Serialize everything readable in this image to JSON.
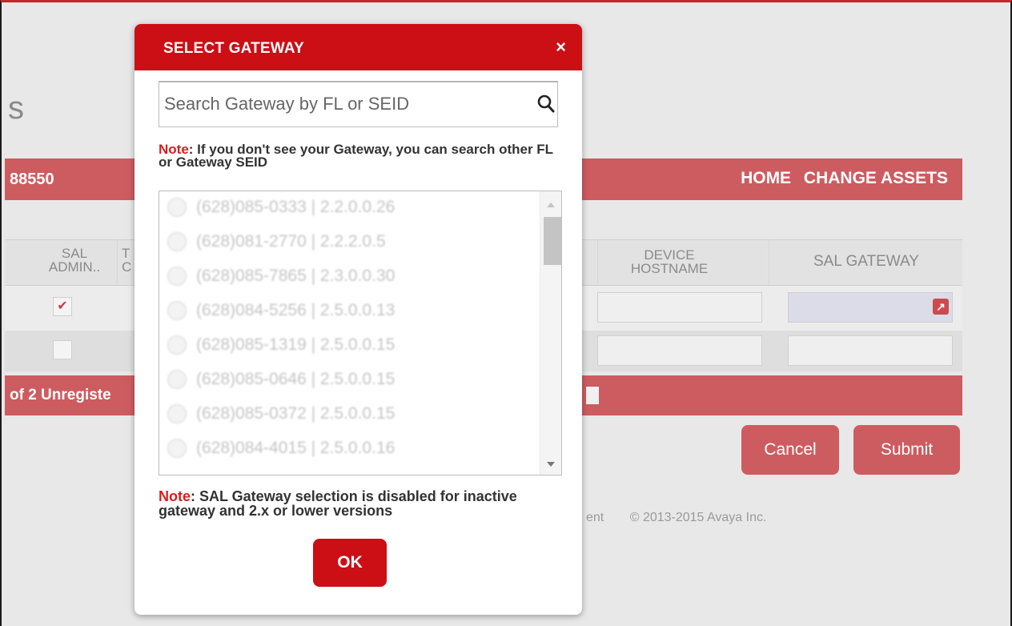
{
  "background": {
    "page_title_fragment": "s",
    "account_fragment": "88550",
    "nav": {
      "home": "HOME",
      "change_assets": "CHANGE ASSETS"
    },
    "table": {
      "headers": {
        "sal_admin": "SAL ADMIN..",
        "col2_fragment": "T C",
        "device_hostname": "DEVICE HOSTNAME",
        "sal_gateway": "SAL GATEWAY"
      },
      "row1_checked": "✔"
    },
    "footer_count": "of 2 Unregiste",
    "buttons": {
      "cancel": "Cancel",
      "submit": "Submit"
    },
    "copyright_prefix": "ent",
    "copyright": "© 2013-2015 Avaya Inc."
  },
  "modal": {
    "title": "SELECT GATEWAY",
    "close_symbol": "×",
    "search": {
      "placeholder": "Search Gateway by FL or SEID",
      "value": ""
    },
    "note_top": {
      "label": "Note",
      "text": ": If you don't see your Gateway, you can search other FL or Gateway SEID"
    },
    "gateways": [
      "(628)085-0333 | 2.2.0.0.26",
      "(628)081-2770 | 2.2.2.0.5",
      "(628)085-7865 | 2.3.0.0.30",
      "(628)084-5256 | 2.5.0.0.13",
      "(628)085-1319 | 2.5.0.0.15",
      "(628)085-0646 | 2.5.0.0.15",
      "(628)085-0372 | 2.5.0.0.15",
      "(628)084-4015 | 2.5.0.0.16"
    ],
    "note_bottom": {
      "label": "Note",
      "text": ": SAL Gateway selection is disabled for inactive gateway and 2.x or lower versions"
    },
    "ok_label": "OK"
  },
  "colors": {
    "brand_red": "#cc0e15",
    "faded_red": "#cd5c60",
    "note_red": "#d81e1e"
  },
  "icons": [
    "search-icon",
    "close-icon",
    "external-link-icon",
    "checkmark-icon"
  ]
}
